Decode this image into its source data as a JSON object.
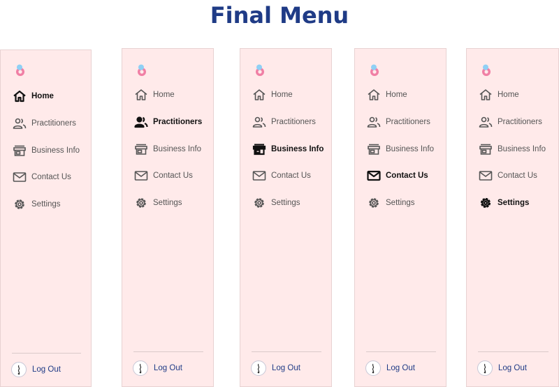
{
  "page": {
    "title": "Final Menu"
  },
  "menu": {
    "items": [
      {
        "label": "Home",
        "icon": "home-icon"
      },
      {
        "label": "Practitioners",
        "icon": "people-icon"
      },
      {
        "label": "Business Info",
        "icon": "store-icon"
      },
      {
        "label": "Contact Us",
        "icon": "mail-icon"
      },
      {
        "label": "Settings",
        "icon": "gear-icon"
      }
    ],
    "logout_label": "Log Out"
  },
  "variants": [
    {
      "active_item": "Home"
    },
    {
      "active_item": "Practitioners"
    },
    {
      "active_item": "Business Info"
    },
    {
      "active_item": "Contact Us"
    },
    {
      "active_item": "Settings"
    }
  ],
  "colors": {
    "title": "#1f3b86",
    "panel_bg": "#ffeaea",
    "active_text": "#111111",
    "inactive_text": "#555555",
    "logout_text": "#1f3b86",
    "logo_blue": "#8fd0f5",
    "logo_pink": "#f07fa5"
  }
}
